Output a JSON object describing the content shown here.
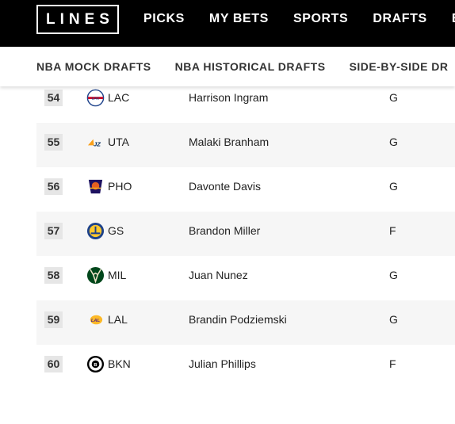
{
  "nav": {
    "logo": "LINES",
    "links": [
      "PICKS",
      "MY BETS",
      "SPORTS",
      "DRAFTS",
      "BE"
    ]
  },
  "subnav": {
    "items": [
      "NBA MOCK DRAFTS",
      "NBA HISTORICAL DRAFTS",
      "SIDE-BY-SIDE DR"
    ]
  },
  "picks": [
    {
      "pick": "54",
      "team": "LAC",
      "player": "Harrison Ingram",
      "pos": "G",
      "logo": "clippers-logo",
      "color": "#c8102e"
    },
    {
      "pick": "55",
      "team": "UTA",
      "player": "Malaki Branham",
      "pos": "G",
      "logo": "jazz-logo",
      "color": "#002b5c"
    },
    {
      "pick": "56",
      "team": "PHO",
      "player": "Davonte Davis",
      "pos": "G",
      "logo": "suns-logo",
      "color": "#e56020"
    },
    {
      "pick": "57",
      "team": "GS",
      "player": "Brandon Miller",
      "pos": "F",
      "logo": "warriors-logo",
      "color": "#1d428a"
    },
    {
      "pick": "58",
      "team": "MIL",
      "player": "Juan Nunez",
      "pos": "G",
      "logo": "bucks-logo",
      "color": "#00471b"
    },
    {
      "pick": "59",
      "team": "LAL",
      "player": "Brandin Podziemski",
      "pos": "G",
      "logo": "lakers-logo",
      "color": "#fdb927"
    },
    {
      "pick": "60",
      "team": "BKN",
      "player": "Julian Phillips",
      "pos": "F",
      "logo": "nets-logo",
      "color": "#000000"
    }
  ]
}
